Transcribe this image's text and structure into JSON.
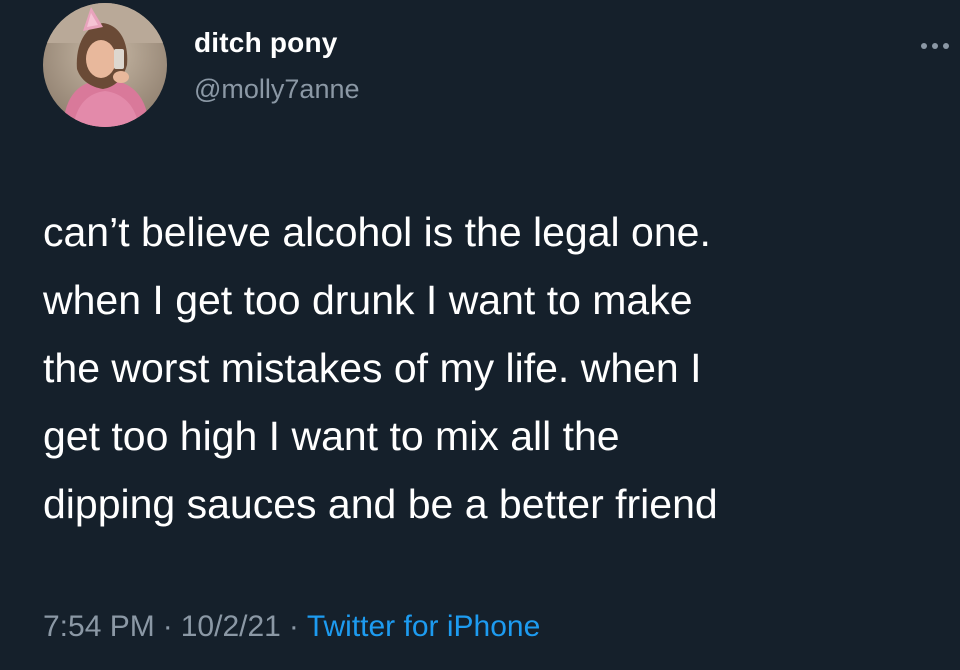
{
  "author": {
    "display_name": "ditch pony",
    "handle": "@molly7anne"
  },
  "tweet": {
    "lines": [
      "can’t believe alcohol is the legal one.",
      "when I get too drunk I want to make",
      "the worst mistakes of my life. when I",
      "get too high I want to mix all the",
      "dipping sauces and be a better friend"
    ]
  },
  "meta": {
    "time": "7:54 PM",
    "separator": "·",
    "date": "10/2/21",
    "source": "Twitter for iPhone"
  },
  "icons": {
    "more": "more-horizontal-icon",
    "avatar": "profile-photo"
  },
  "colors": {
    "background": "#15202b",
    "primary_text": "#ffffff",
    "secondary_text": "#8b98a5",
    "link": "#1d9bf0"
  }
}
